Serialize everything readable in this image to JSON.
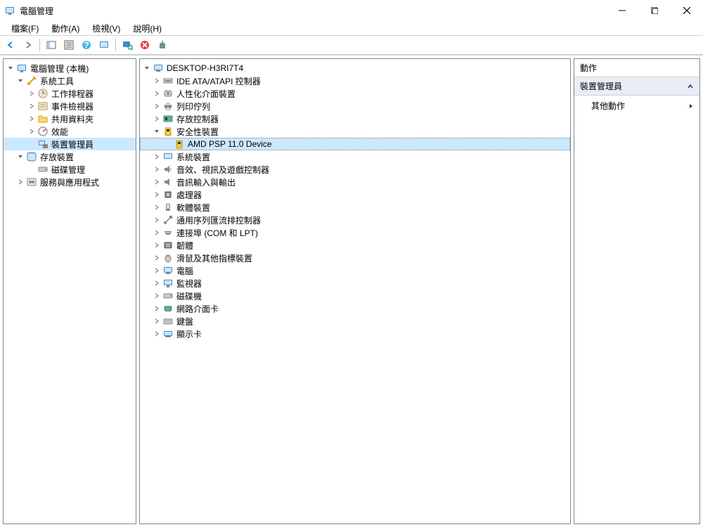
{
  "titlebar": {
    "title": "電腦管理"
  },
  "menubar": {
    "file": "檔案(F)",
    "action": "動作(A)",
    "view": "檢視(V)",
    "help": "說明(H)"
  },
  "left_tree": {
    "root": "電腦管理 (本機)",
    "system_tools": "系統工具",
    "task_scheduler": "工作排程器",
    "event_viewer": "事件檢視器",
    "shared_folders": "共用資料夾",
    "performance": "效能",
    "device_manager": "裝置管理員",
    "storage": "存放裝置",
    "disk_management": "磁碟管理",
    "services_apps": "服務與應用程式"
  },
  "center_tree": {
    "computer": "DESKTOP-H3RI7T4",
    "ide_atapi": "IDE ATA/ATAPI 控制器",
    "hid": "人性化介面裝置",
    "print_queues": "列印佇列",
    "storage_controllers": "存放控制器",
    "security_devices": "安全性裝置",
    "amd_psp": "AMD PSP 11.0 Device",
    "system_devices": "系統裝置",
    "sound_video_game": "音效、視訊及遊戲控制器",
    "audio_io": "音訊輸入與輸出",
    "processors": "處理器",
    "software_devices": "軟體裝置",
    "usb_controllers": "通用序列匯流排控制器",
    "ports": "連接埠 (COM 和 LPT)",
    "firmware": "韌體",
    "mice": "滑鼠及其他指標裝置",
    "computer_cat": "電腦",
    "monitors": "監視器",
    "disk_drives": "磁碟機",
    "network_adapters": "網路介面卡",
    "keyboards": "鍵盤",
    "display_adapters": "顯示卡"
  },
  "actions": {
    "header": "動作",
    "section": "裝置管理員",
    "more": "其他動作"
  }
}
